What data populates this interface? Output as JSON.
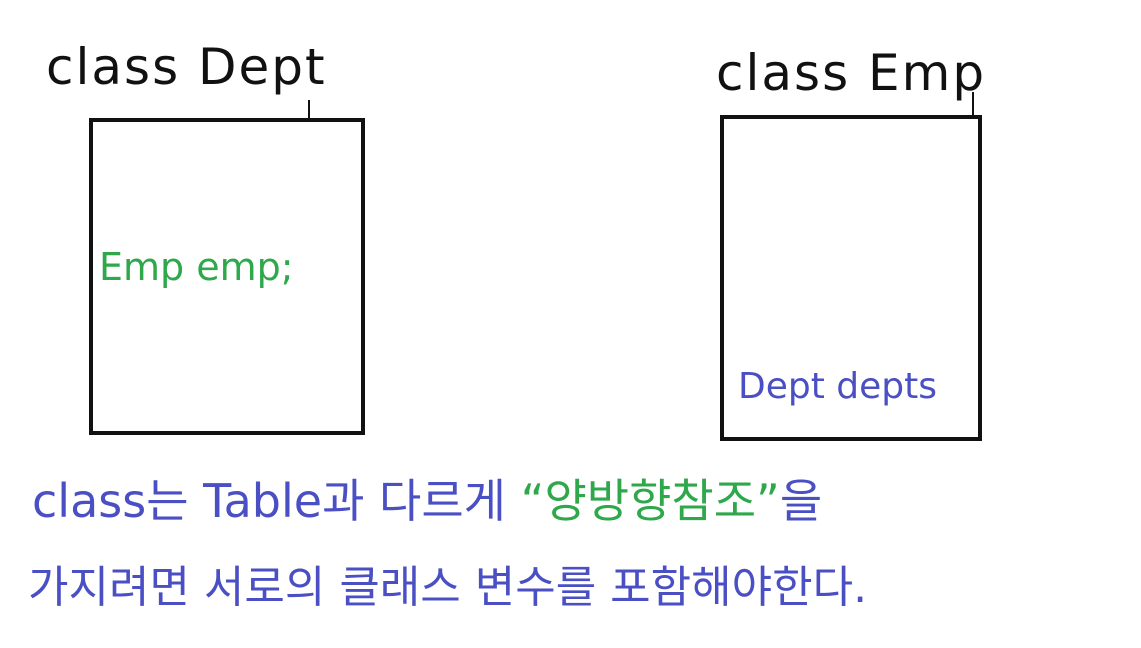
{
  "colors": {
    "ink": "#111111",
    "green": "#2ea84b",
    "blue": "#4a4fc4"
  },
  "dept_class": {
    "title": "class Dept",
    "field": "Emp emp;"
  },
  "emp_class": {
    "title": "class Emp",
    "field": "Dept depts"
  },
  "note": {
    "line1_part1": "class는 Table과 다르게 ",
    "line1_quoted": "“양방향참조”",
    "line1_part2": "을",
    "line2": "가지려면 서로의 클래스 변수를 포함해야한다."
  }
}
